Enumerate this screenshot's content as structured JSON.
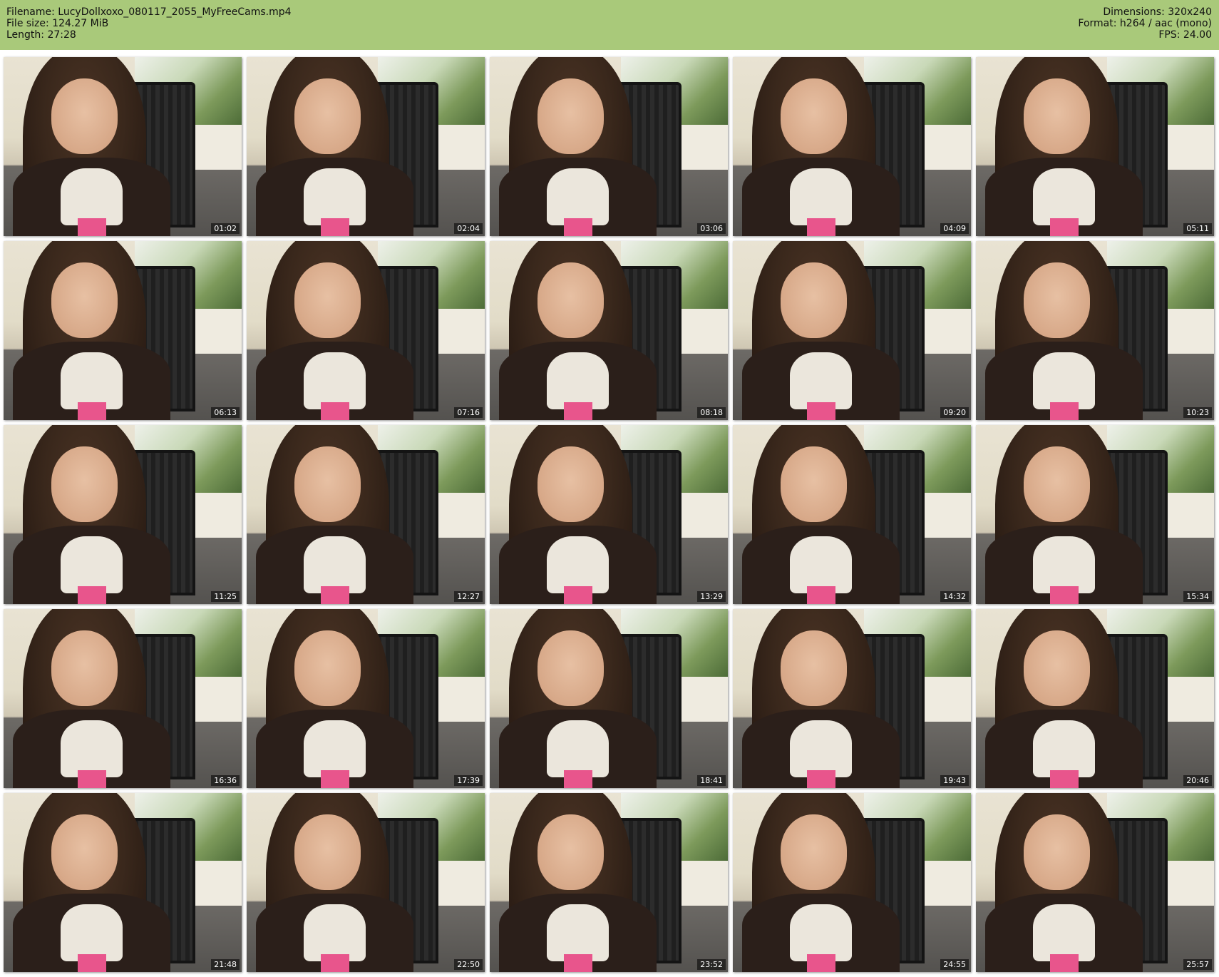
{
  "header": {
    "filename_line": "Filename: LucyDollxoxo_080117_2055_MyFreeCams.mp4",
    "filesize_line": "File size: 124.27 MiB",
    "length_line": "Length: 27:28",
    "dimensions_line": "Dimensions: 320x240",
    "format_line": "Format: h264 / aac (mono)",
    "fps_line": "FPS: 24.00"
  },
  "colors": {
    "header_bg": "#a9c97a",
    "page_bg": "#ffffff"
  },
  "thumbnails": [
    {
      "timestamp": "01:02"
    },
    {
      "timestamp": "02:04"
    },
    {
      "timestamp": "03:06"
    },
    {
      "timestamp": "04:09"
    },
    {
      "timestamp": "05:11"
    },
    {
      "timestamp": "06:13"
    },
    {
      "timestamp": "07:16"
    },
    {
      "timestamp": "08:18"
    },
    {
      "timestamp": "09:20"
    },
    {
      "timestamp": "10:23"
    },
    {
      "timestamp": "11:25"
    },
    {
      "timestamp": "12:27"
    },
    {
      "timestamp": "13:29"
    },
    {
      "timestamp": "14:32"
    },
    {
      "timestamp": "15:34"
    },
    {
      "timestamp": "16:36"
    },
    {
      "timestamp": "17:39"
    },
    {
      "timestamp": "18:41"
    },
    {
      "timestamp": "19:43"
    },
    {
      "timestamp": "20:46"
    },
    {
      "timestamp": "21:48"
    },
    {
      "timestamp": "22:50"
    },
    {
      "timestamp": "23:52"
    },
    {
      "timestamp": "24:55"
    },
    {
      "timestamp": "25:57"
    }
  ]
}
